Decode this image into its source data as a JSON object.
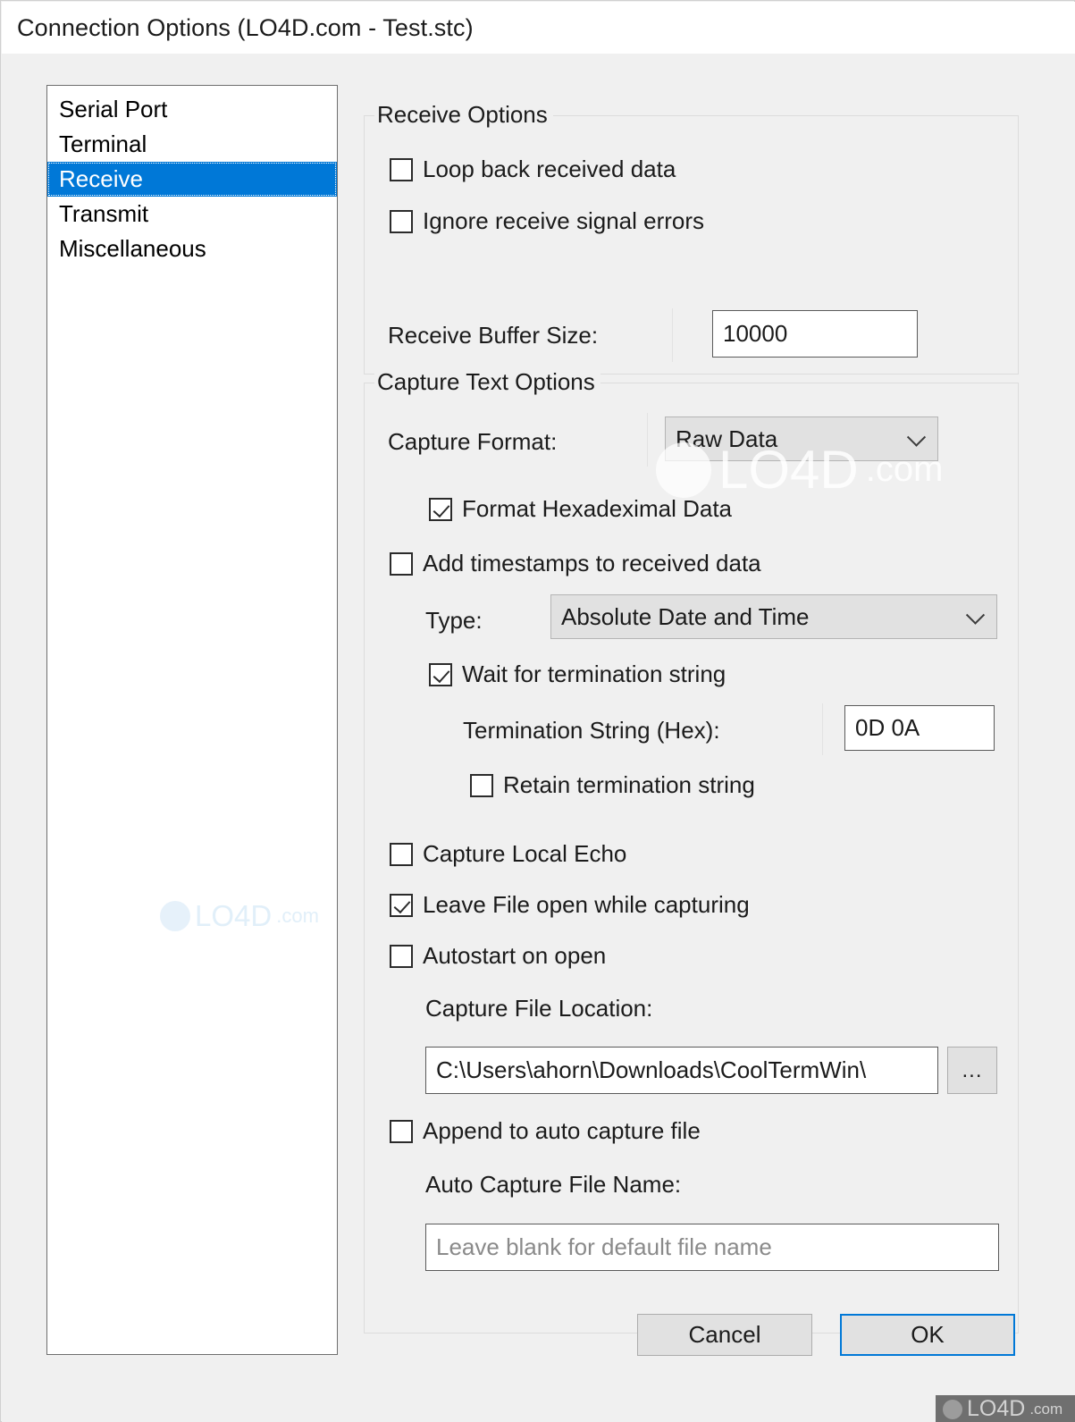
{
  "window": {
    "title": "Connection Options (LO4D.com - Test.stc)"
  },
  "sidebar": {
    "items": [
      {
        "label": "Serial Port",
        "selected": false
      },
      {
        "label": "Terminal",
        "selected": false
      },
      {
        "label": "Receive",
        "selected": true
      },
      {
        "label": "Transmit",
        "selected": false
      },
      {
        "label": "Miscellaneous",
        "selected": false
      }
    ]
  },
  "receive_options": {
    "legend": "Receive Options",
    "loop_back_label": "Loop back received data",
    "loop_back_checked": false,
    "ignore_errors_label": "Ignore receive signal errors",
    "ignore_errors_checked": false,
    "buffer_size_label": "Receive Buffer Size:",
    "buffer_size_value": "10000"
  },
  "capture_options": {
    "legend": "Capture Text Options",
    "capture_format_label": "Capture Format:",
    "capture_format_value": "Raw Data",
    "format_hex_label": "Format Hexadeximal Data",
    "format_hex_checked": true,
    "add_timestamps_label": "Add timestamps to received data",
    "add_timestamps_checked": false,
    "type_label": "Type:",
    "type_value": "Absolute Date and Time",
    "wait_termination_label": "Wait for termination string",
    "wait_termination_checked": true,
    "termination_string_label": "Termination String (Hex):",
    "termination_string_value": "0D 0A",
    "retain_termination_label": "Retain termination string",
    "retain_termination_checked": false,
    "capture_local_echo_label": "Capture Local Echo",
    "capture_local_echo_checked": false,
    "leave_file_open_label": "Leave File open while capturing",
    "leave_file_open_checked": true,
    "autostart_label": "Autostart on open",
    "autostart_checked": false,
    "capture_file_location_label": "Capture File Location:",
    "capture_file_location_value": "C:\\Users\\ahorn\\Downloads\\CoolTermWin\\",
    "browse_button_label": "...",
    "append_label": "Append to auto capture file",
    "append_checked": false,
    "auto_capture_name_label": "Auto Capture File Name:",
    "auto_capture_name_placeholder": "Leave blank for default file name"
  },
  "footer": {
    "cancel_label": "Cancel",
    "ok_label": "OK"
  },
  "watermark": {
    "brand": "LO4D",
    "suffix": ".com"
  },
  "colors": {
    "accent": "#0078d7",
    "selection": "#0078d7",
    "window_bg": "#f0f0f0",
    "field_bg": "#ffffff",
    "combo_bg": "#e1e1e1",
    "badge_bg": "#6f6f6f"
  }
}
